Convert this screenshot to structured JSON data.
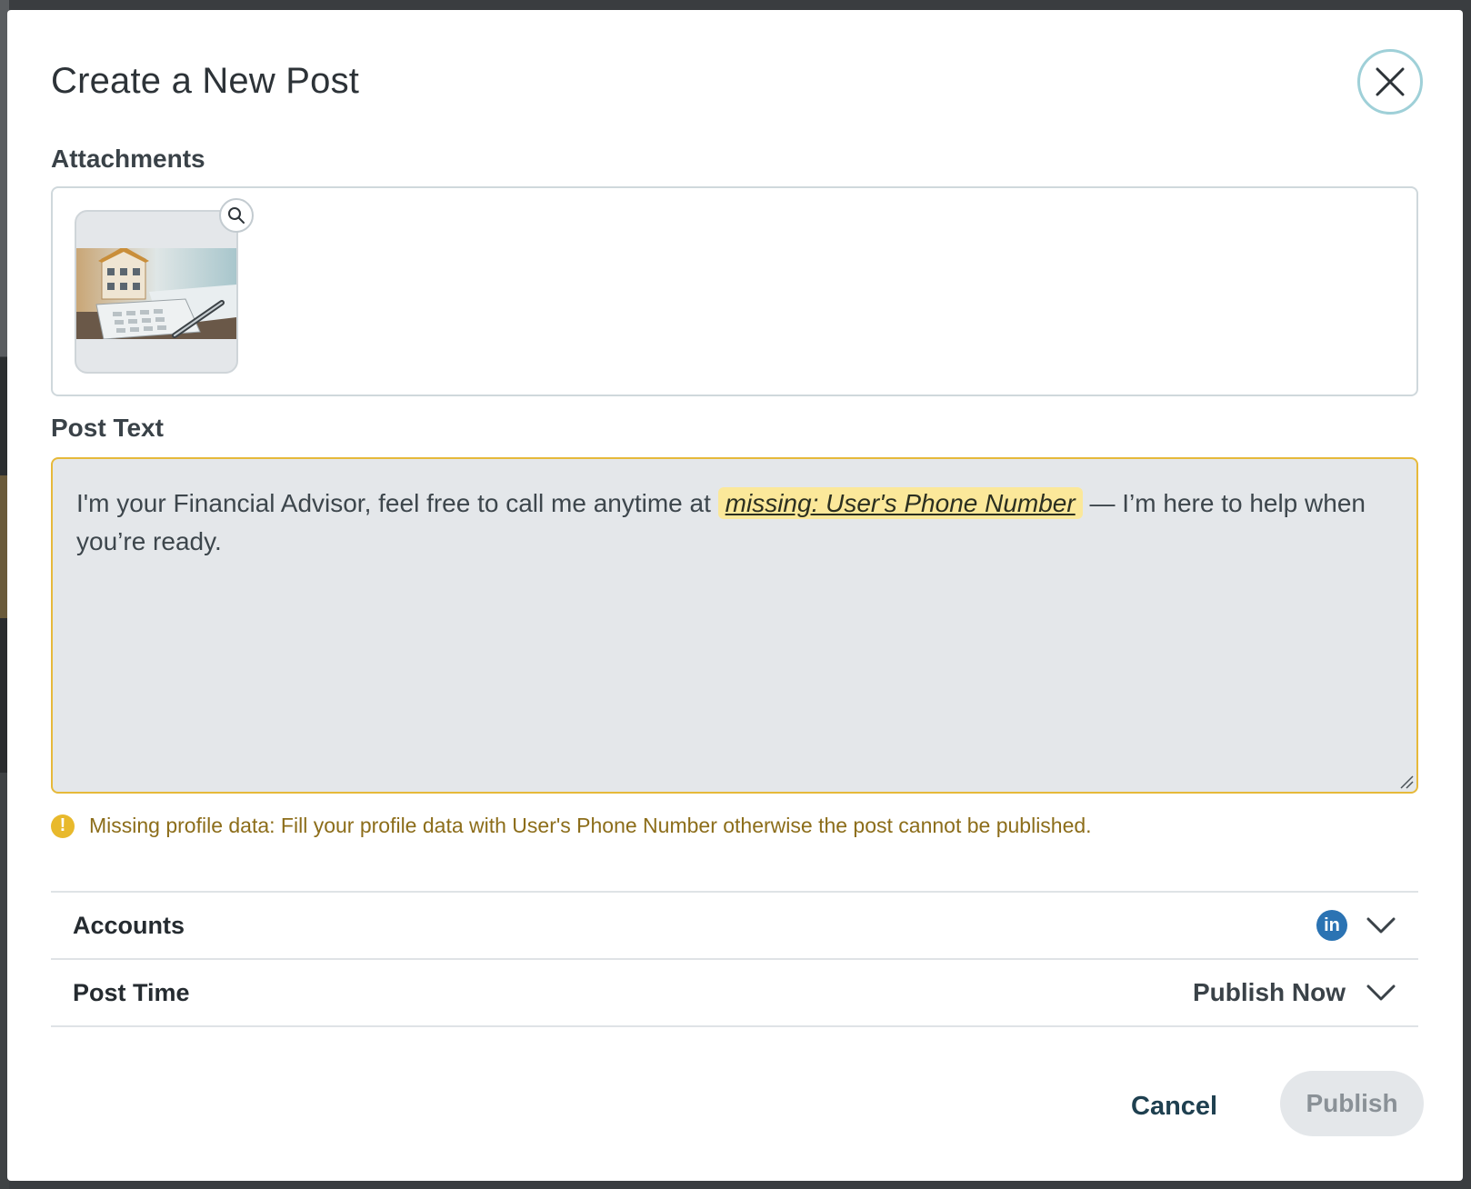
{
  "modal": {
    "title": "Create a New Post"
  },
  "attachments": {
    "label": "Attachments",
    "items": [
      {
        "icon": "house-calculator-image",
        "zoom_icon": "search-icon"
      }
    ]
  },
  "post_text": {
    "label": "Post Text",
    "before": "I'm your Financial Advisor, feel free to call me anytime at",
    "placeholder_chip": "missing: User's Phone Number",
    "after": "— I’m here to help when you’re ready."
  },
  "warning": {
    "icon": "exclamation-icon",
    "text": "Missing profile data: Fill your profile data with User's Phone Number otherwise the post cannot be published."
  },
  "accounts": {
    "label": "Accounts",
    "network_icon": "linkedin-icon",
    "network_glyph": "in"
  },
  "post_time": {
    "label": "Post Time",
    "value": "Publish Now"
  },
  "footer": {
    "cancel_label": "Cancel",
    "publish_label": "Publish"
  },
  "colors": {
    "accent_border": "#e6b93a",
    "chip_bg": "#fbe89a",
    "warning_text": "#8c6d1a",
    "linkedin": "#2b73b3",
    "close_ring": "#9fd0d8"
  }
}
